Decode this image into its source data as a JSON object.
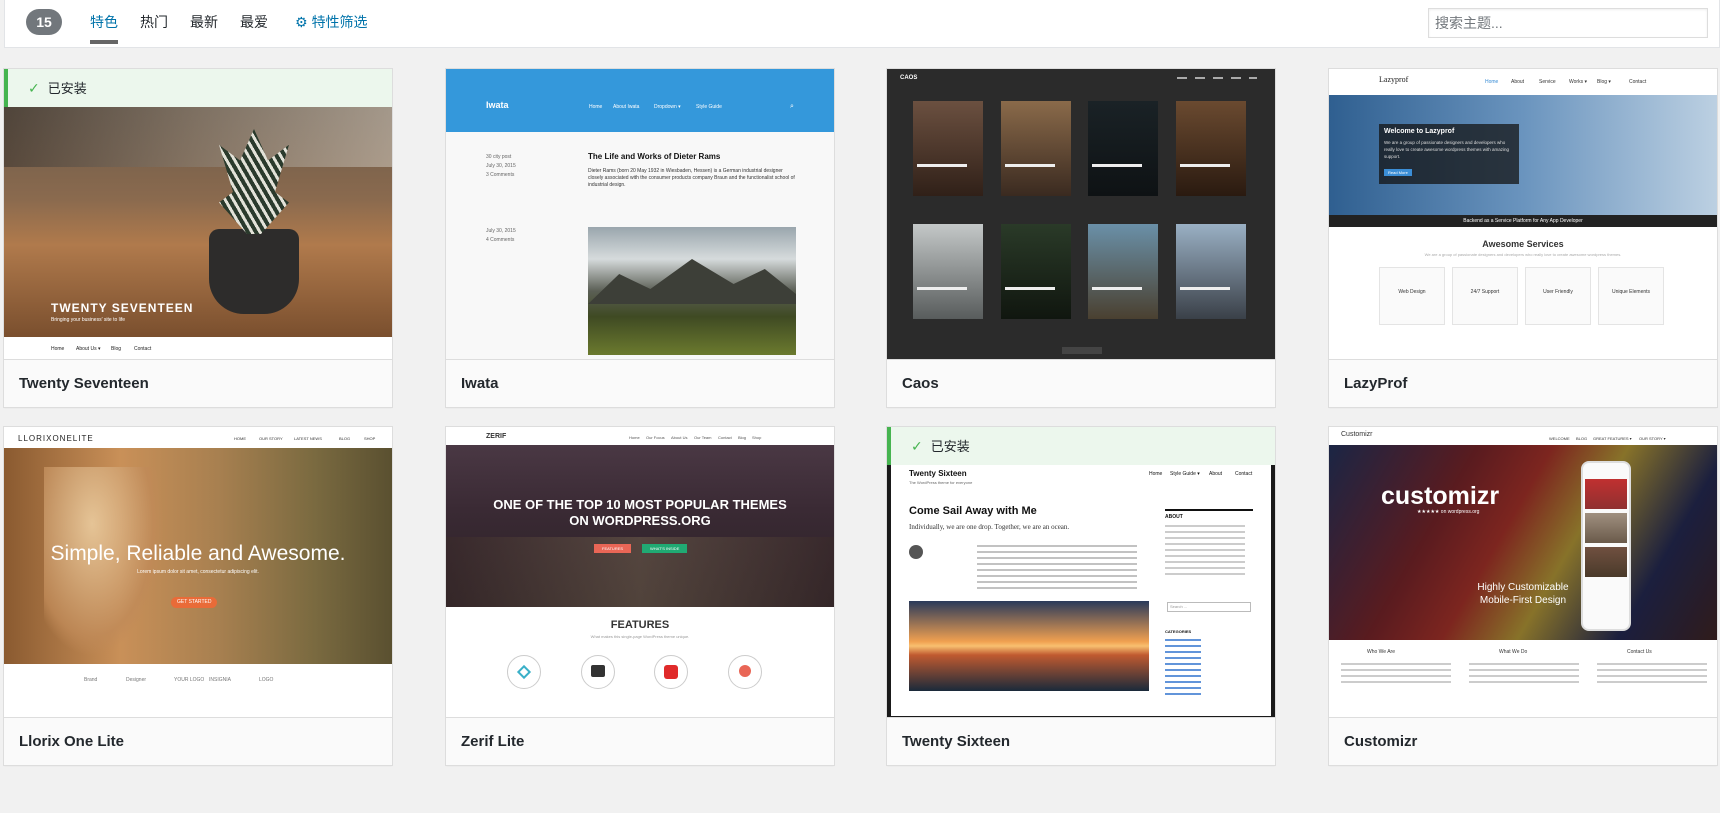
{
  "filter_bar": {
    "count": "15",
    "tabs": [
      {
        "label": "特色",
        "current": true
      },
      {
        "label": "热门",
        "current": false
      },
      {
        "label": "最新",
        "current": false
      },
      {
        "label": "最爱",
        "current": false
      }
    ],
    "feature_filter": {
      "icon": "gear-icon",
      "label": "特性筛选"
    },
    "search_placeholder": "搜索主题..."
  },
  "themes": [
    {
      "name": "Twenty Seventeen",
      "installed": true,
      "installed_label": "已安装",
      "shot": {
        "title": "TWENTY SEVENTEEN",
        "tagline": "Bringing your business' site to life",
        "nav": [
          "Home",
          "About Us ▾",
          "Blog",
          "Contact"
        ]
      }
    },
    {
      "name": "Iwata",
      "installed": false,
      "shot": {
        "brand": "Iwata",
        "nav": [
          "Home",
          "About Iwata",
          "Dropdown ▾",
          "Style Guide"
        ],
        "post_title": "The Life and Works of Dieter Rams",
        "post_body": "Dieter Rams (born 20 May 1932 in Wiesbaden, Hessen) is a German industrial designer closely associated with the consumer products company Braun and the functionalist school of industrial design.",
        "meta1": [
          "30 city post",
          "July 30, 2015",
          "3 Comments"
        ],
        "meta2": [
          "July 30, 2015",
          "4 Comments"
        ]
      }
    },
    {
      "name": "Caos",
      "installed": false,
      "shot": {
        "brand": "CAOS"
      }
    },
    {
      "name": "LazyProf",
      "installed": false,
      "shot": {
        "brand": "Lazyprof",
        "nav": [
          "Home",
          "About",
          "Service",
          "Works ▾",
          "Blog ▾",
          "Contact"
        ],
        "hero_title": "Welcome to Lazyprof",
        "hero_text": "We are a group of passionate designers and developers who really love to create awesome wordpress themes with amazing support.",
        "hero_button": "Read More",
        "banner": "Backend as a Service Platform for Any App Developer",
        "section_title": "Awesome Services",
        "section_sub": "We are a group of passionate designers and developers who really love to create awesome wordpress themes.",
        "services": [
          "Web Design",
          "24/7 Support",
          "User Friendly",
          "Unique Elements"
        ],
        "service_text": "We are a group of passionate designers and developers"
      }
    },
    {
      "name": "Llorix One Lite",
      "installed": false,
      "shot": {
        "brand": "LLORIXONELITE",
        "nav": [
          "HOME",
          "OUR STORY",
          "LATEST NEWS",
          "BLOG",
          "SHOP"
        ],
        "hero": "Simple, Reliable and Awesome.",
        "hero_sub": "Lorem ipsum dolor sit amet, consectetur adipiscing elit.",
        "button": "GET STARTED",
        "logos": [
          "Brand",
          "Designer",
          "YOUR LOGO",
          "INSIGNIA",
          "LOGO"
        ]
      }
    },
    {
      "name": "Zerif Lite",
      "installed": false,
      "shot": {
        "brand": "ZERIF",
        "nav": [
          "Home",
          "Our Focus",
          "About Us",
          "Our Team",
          "Contact",
          "Blog",
          "Shop"
        ],
        "hero": "ONE OF THE TOP 10 MOST POPULAR THEMES ON WORDPRESS.ORG",
        "btn1": "FEATURES",
        "btn2": "WHAT'S INSIDE",
        "section": "FEATURES",
        "section_sub": "What makes this single-page WordPress theme unique."
      }
    },
    {
      "name": "Twenty Sixteen",
      "installed": true,
      "installed_label": "已安装",
      "shot": {
        "brand": "Twenty Sixteen",
        "tagline": "The WordPress theme for everyone",
        "nav": [
          "Home",
          "Style Guide ▾",
          "About",
          "Contact"
        ],
        "post_title": "Come Sail Away with Me",
        "post_intro": "Individually, we are one drop.  Together, we are an ocean.",
        "widget_about": "ABOUT",
        "widget_categories": "CATEGORIES",
        "categories": [
          "Detroit",
          "Adventure",
          "Alaska",
          "Art",
          "Cats",
          "Design",
          "Exploring",
          "Fashion"
        ],
        "search_label": "Search ..."
      }
    },
    {
      "name": "Customizr",
      "installed": false,
      "shot": {
        "brand": "Customizr",
        "nav": [
          "WELCOME",
          "BLOG",
          "GREAT FEATURES ▾",
          "OUR STORY ▾"
        ],
        "hero": "customizr",
        "rating": "★★★★★ on wordpress.org",
        "sub1": "Highly Customizable",
        "sub2": "Mobile-First Design",
        "cols": [
          "Who We Are",
          "What We Do",
          "Contact Us"
        ],
        "col_text": "Lorem ipsum dolor sit amet, sed do eiusmod tempor incididunt ut labore et dolore magna aliqua. Color"
      }
    }
  ],
  "colors": {
    "accent": "#0073aa",
    "installed_bg": "#ecf7ed",
    "installed_border": "#46b450",
    "badge": "#72777c"
  }
}
